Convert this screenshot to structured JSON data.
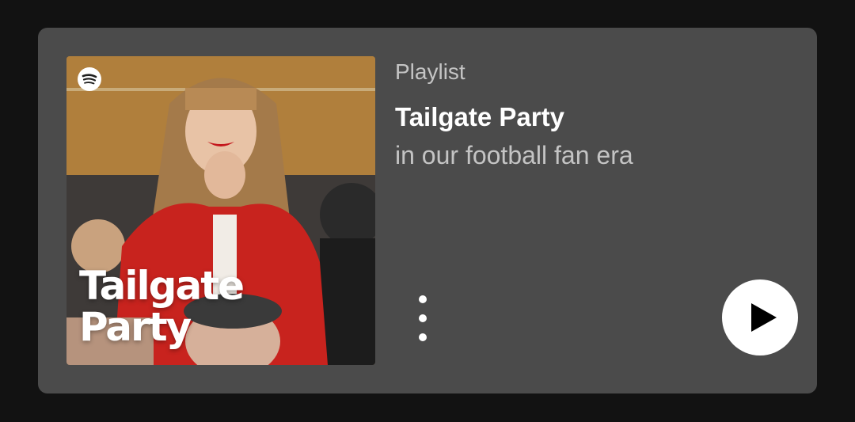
{
  "playlist": {
    "type_label": "Playlist",
    "title": "Tailgate Party",
    "description": "in our football fan era"
  },
  "cover": {
    "title_line1": "Tailgate",
    "title_line2": "Party",
    "logo_icon": "spotify-logo-icon"
  },
  "actions": {
    "more_icon": "more-vertical-icon",
    "play_icon": "play-icon"
  },
  "colors": {
    "page_background": "#121212",
    "card_background": "#4b4b4b",
    "primary_text": "#ffffff",
    "secondary_text": "#c4c4c4",
    "play_button": "#ffffff"
  }
}
